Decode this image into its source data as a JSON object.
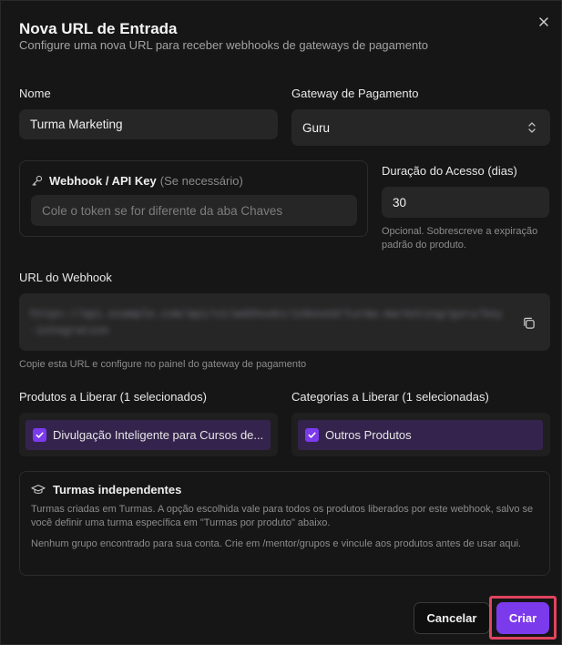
{
  "dialog": {
    "title": "Nova URL de Entrada",
    "subtitle": "Configure uma nova URL para receber webhooks de gateways de pagamento"
  },
  "form": {
    "name": {
      "label": "Nome",
      "value": "Turma Marketing"
    },
    "gateway": {
      "label": "Gateway de Pagamento",
      "value": "Guru"
    },
    "webhook_key": {
      "label": "Webhook / API Key",
      "label_suffix": "(Se necessário)",
      "placeholder": "Cole o token se for diferente da aba Chaves"
    },
    "duration": {
      "label": "Duração do Acesso (dias)",
      "value": "30",
      "hint": "Opcional. Sobrescreve a expiração padrão do produto."
    },
    "webhook_url": {
      "label": "URL do Webhook",
      "value": "https://api.example.com/api/v1/webhooks/inbound/turma-marketing/guru/key-integration",
      "hint": "Copie esta URL e configure no painel do gateway de pagamento"
    },
    "products": {
      "label": "Produtos a Liberar (1 selecionados)",
      "items": [
        "Divulgação Inteligente para Cursos de..."
      ]
    },
    "categories": {
      "label": "Categorias a Liberar (1 selecionadas)",
      "items": [
        "Outros Produtos"
      ]
    },
    "turmas": {
      "title": "Turmas independentes",
      "description": "Turmas criadas em Turmas. A opção escolhida vale para todos os produtos liberados por este webhook, salvo se você definir uma turma específica em \"Turmas por produto\" abaixo.",
      "empty": "Nenhum grupo encontrado para sua conta. Crie em /mentor/grupos e vincule aos produtos antes de usar aqui."
    }
  },
  "actions": {
    "cancel": "Cancelar",
    "create": "Criar"
  },
  "colors": {
    "accent": "#7c3aed",
    "highlight": "#e0445f"
  }
}
